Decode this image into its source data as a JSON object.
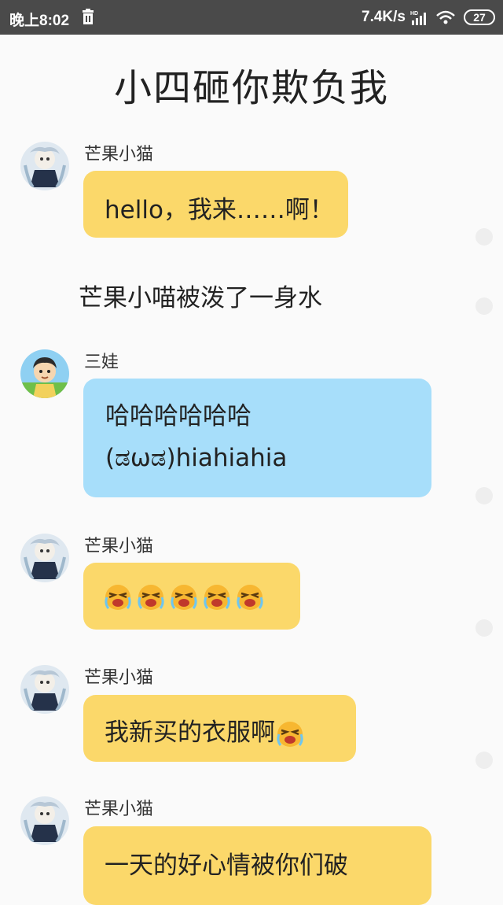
{
  "status_bar": {
    "time": "晚上8:02",
    "network_speed": "7.4K/s",
    "signal_label": "HD",
    "battery_level": "27",
    "icons": [
      "trash-icon",
      "signal-icon",
      "wifi-icon",
      "battery-icon"
    ]
  },
  "title": "小四砸你欺负我",
  "messages": [
    {
      "type": "chat",
      "sender": "芒果小猫",
      "text": "hello，我来……啊！"
    },
    {
      "type": "narration",
      "text": "芒果小喵被泼了一身水"
    },
    {
      "type": "chat",
      "sender": "三娃",
      "line1": "哈哈哈哈哈哈",
      "line2": "(ಡωಡ)hiahiahia"
    },
    {
      "type": "chat",
      "sender": "芒果小猫",
      "emoji": "crying-face-emoji",
      "emoji_count": 5
    },
    {
      "type": "chat",
      "sender": "芒果小猫",
      "text": "我新买的衣服啊",
      "emoji": "crying-face-emoji"
    },
    {
      "type": "chat",
      "sender": "芒果小猫",
      "text": "一天的好心情被你们破"
    }
  ],
  "colors": {
    "bubble_yellow": "#fbd86a",
    "bubble_blue": "#a7defa",
    "status_bar": "#4a4a4a"
  }
}
